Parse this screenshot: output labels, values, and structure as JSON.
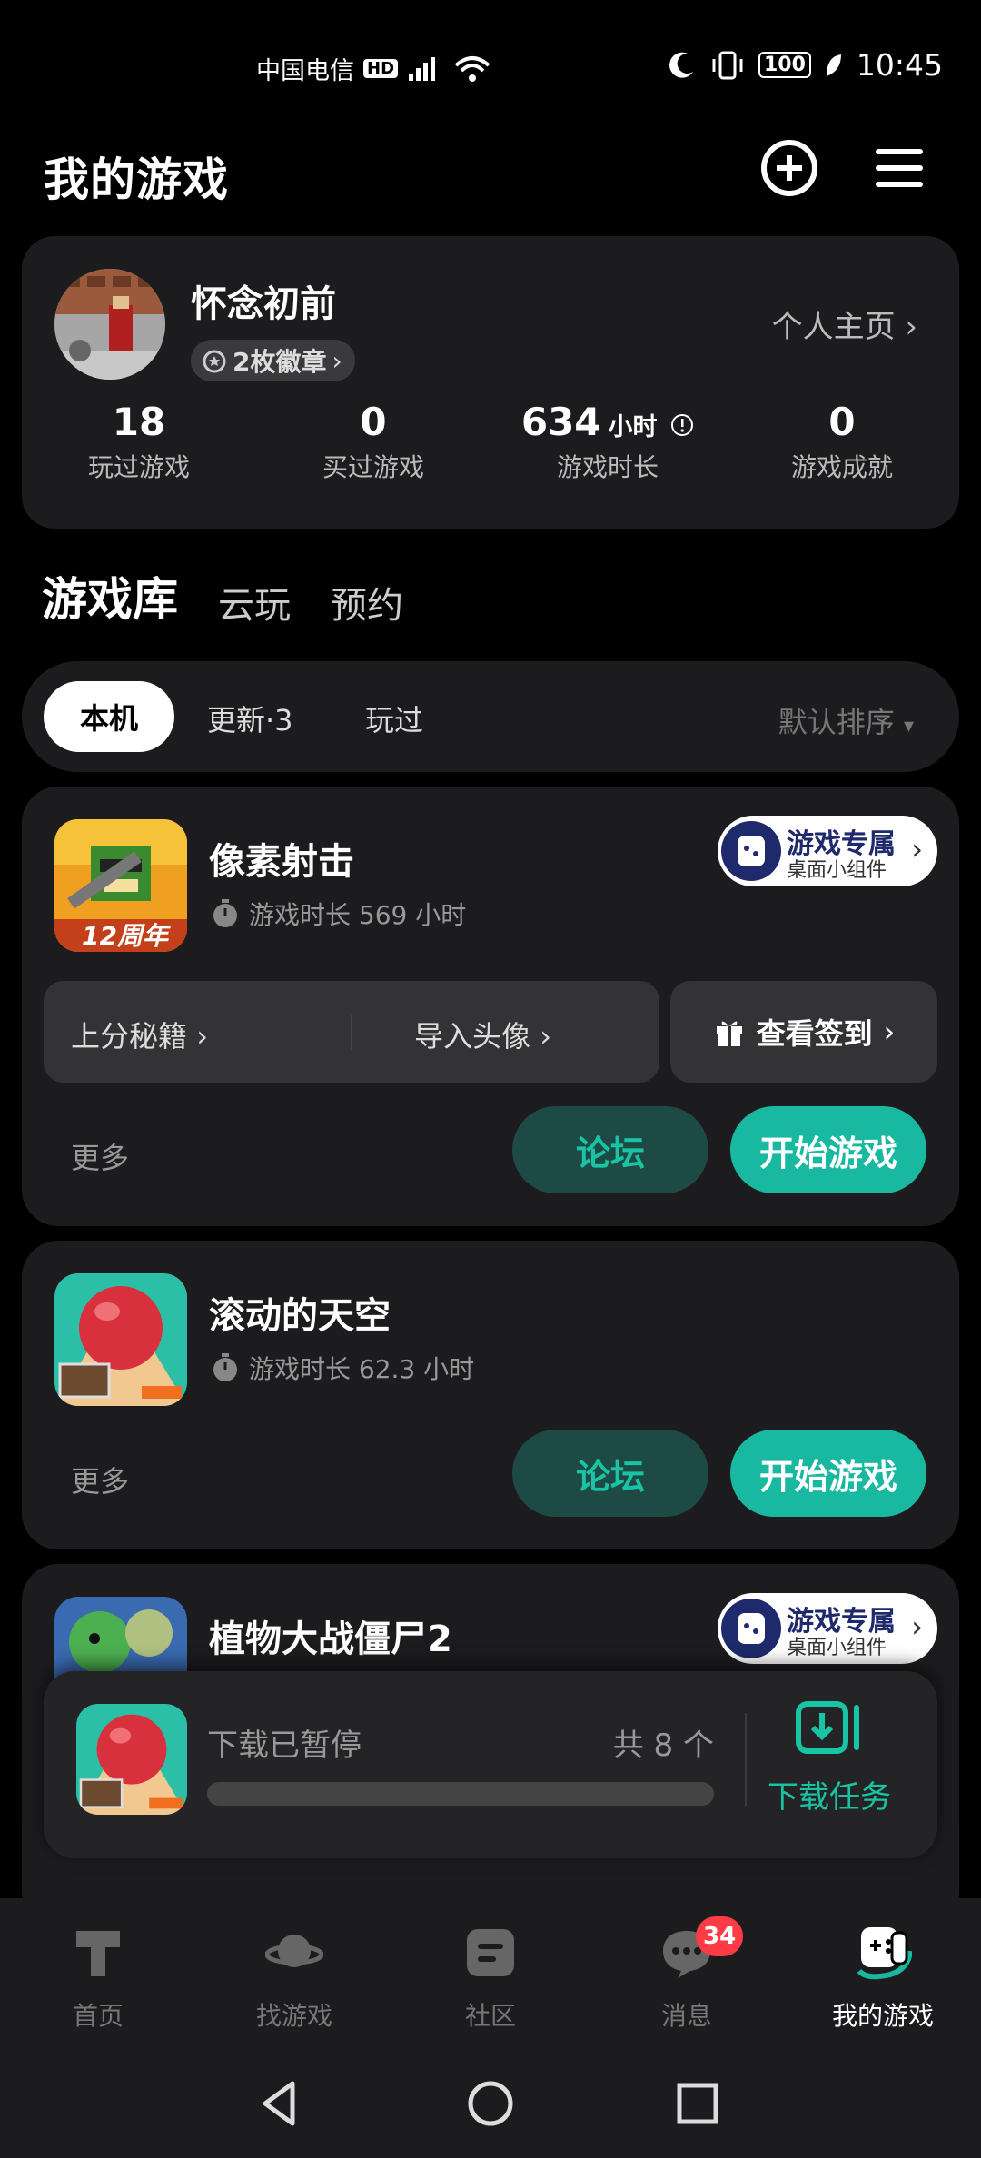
{
  "status_bar": {
    "carrier": "中国电信",
    "hd_label": "HD",
    "battery": "100",
    "time": "10:45"
  },
  "header": {
    "title": "我的游戏",
    "add_icon": "plus-circle-icon",
    "menu_icon": "hamburger-menu-icon"
  },
  "profile": {
    "username": "怀念初前",
    "badges": "2枚徽章",
    "homepage_link": "个人主页",
    "stats": [
      {
        "value": "18",
        "unit": "",
        "label": "玩过游戏"
      },
      {
        "value": "0",
        "unit": "",
        "label": "买过游戏"
      },
      {
        "value": "634",
        "unit": "小时",
        "label": "游戏时长"
      },
      {
        "value": "0",
        "unit": "",
        "label": "游戏成就"
      }
    ]
  },
  "library_tabs": [
    {
      "label": "游戏库",
      "active": true
    },
    {
      "label": "云玩",
      "active": false
    },
    {
      "label": "预约",
      "active": false
    }
  ],
  "filters": {
    "items": [
      "本机",
      "更新·3",
      "玩过"
    ],
    "selected": "本机",
    "sort_label": "默认排序"
  },
  "games": [
    {
      "name": "像素射击",
      "playtime": "游戏时长 569 小时",
      "icon_text": "12周年",
      "widget_title": "游戏专属",
      "widget_sub": "桌面小组件",
      "quick_links": [
        "上分秘籍",
        "导入头像"
      ],
      "checkin_label": "查看签到",
      "more_label": "更多",
      "forum_label": "论坛",
      "start_label": "开始游戏"
    },
    {
      "name": "滚动的天空",
      "playtime": "游戏时长 62.3 小时",
      "more_label": "更多",
      "forum_label": "论坛",
      "start_label": "开始游戏"
    },
    {
      "name": "植物大战僵尸2",
      "widget_title": "游戏专属",
      "widget_sub": "桌面小组件"
    }
  ],
  "download": {
    "status": "下载已暂停",
    "count": "共 8 个",
    "tasks_label": "下载任务",
    "progress": 0
  },
  "bottom_nav": [
    {
      "label": "首页",
      "icon": "home-icon",
      "active": false
    },
    {
      "label": "找游戏",
      "icon": "planet-icon",
      "active": false
    },
    {
      "label": "社区",
      "icon": "community-icon",
      "active": false
    },
    {
      "label": "消息",
      "icon": "message-icon",
      "active": false,
      "badge": "34"
    },
    {
      "label": "我的游戏",
      "icon": "gamepad-icon",
      "active": true
    }
  ],
  "colors": {
    "accent": "#18b9a0",
    "card_bg": "#1c1c1e",
    "badge_red": "#ff3b46"
  }
}
